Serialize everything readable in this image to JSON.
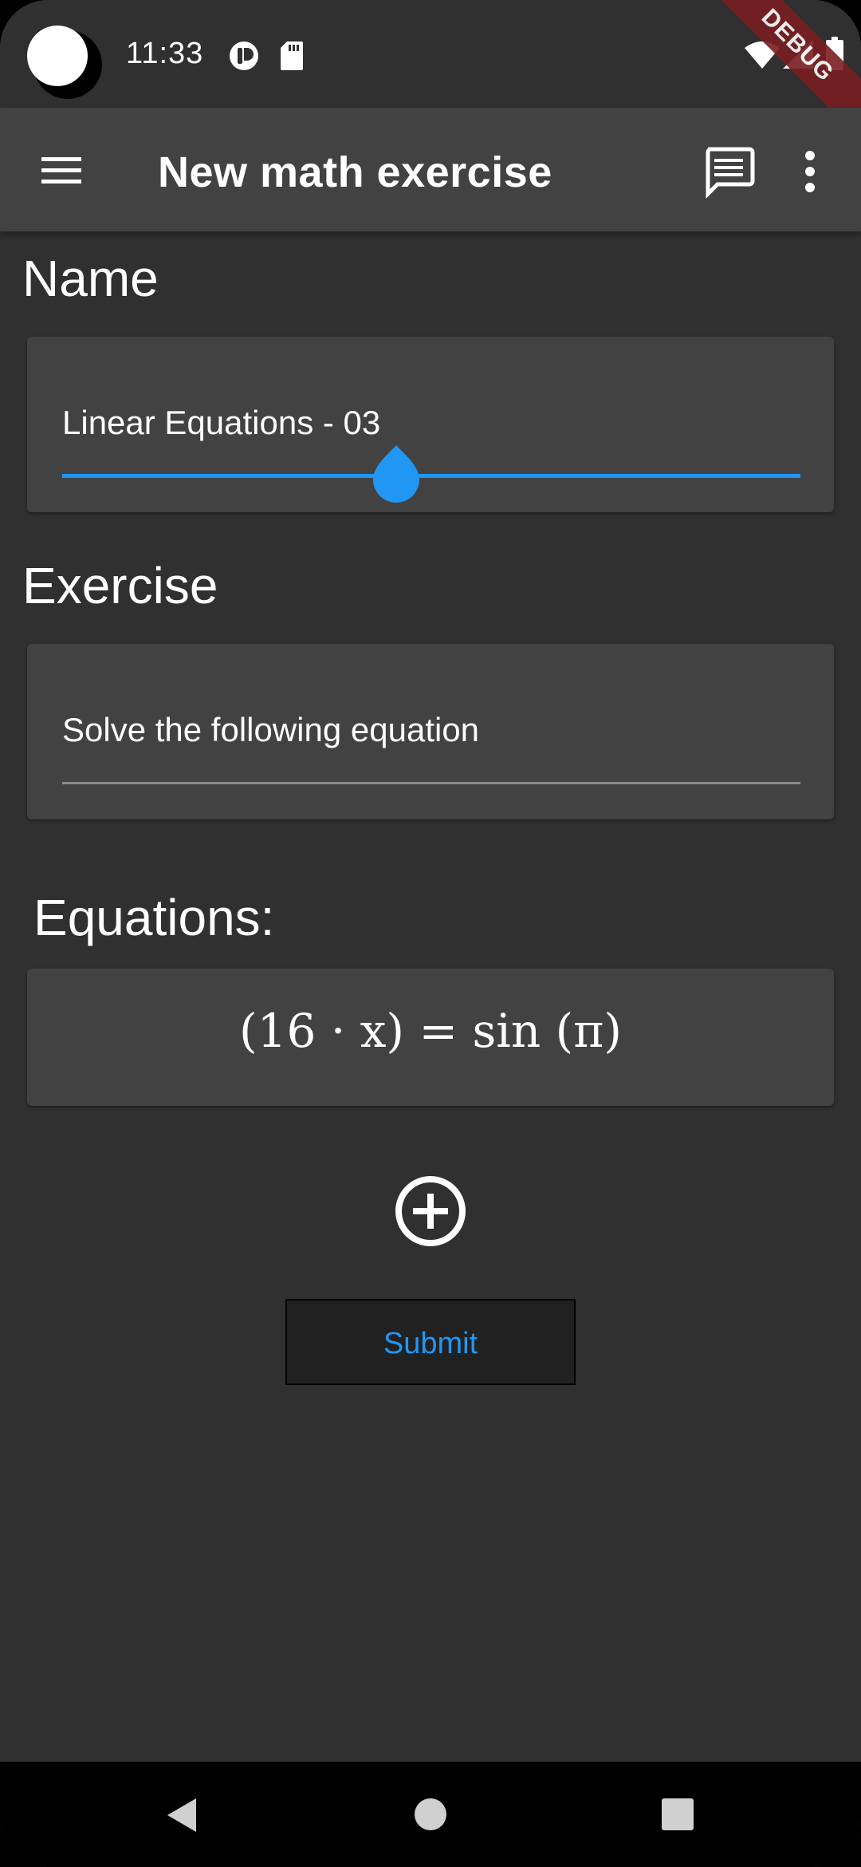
{
  "status_bar": {
    "time": "11:33",
    "debug_banner": "DEBUG"
  },
  "app_bar": {
    "title": "New math exercise",
    "icons": [
      "menu-icon",
      "chat-icon",
      "more-vert-icon"
    ]
  },
  "name_section": {
    "label": "Name",
    "value": "Linear Equations - 03"
  },
  "exercise_section": {
    "label": "Exercise",
    "value": "Solve the following equation"
  },
  "equations_section": {
    "label": "Equations:",
    "items": [
      "(16 · x) = sin (π)"
    ]
  },
  "actions": {
    "add_icon": "add-circle-icon",
    "submit_label": "Submit"
  },
  "colors": {
    "background": "#303030",
    "app_bar": "#424242",
    "card": "#424242",
    "accent": "#2196f3",
    "debug_banner": "#7a1e22"
  }
}
